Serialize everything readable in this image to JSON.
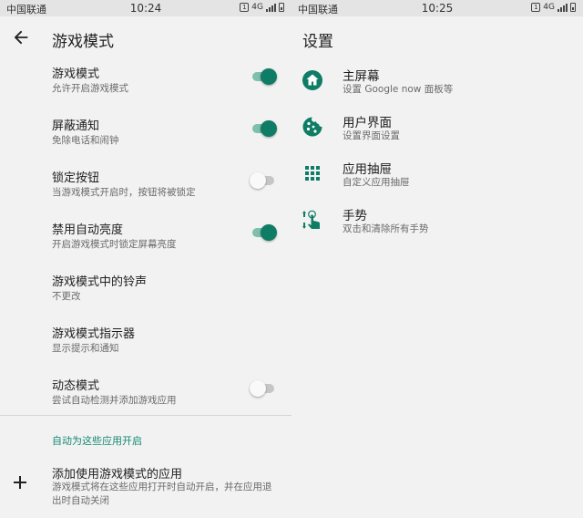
{
  "colors": {
    "accent": "#0f7c66",
    "accent_light": "#7fbfad",
    "section_header": "#138a72"
  },
  "left": {
    "statusbar": {
      "carrier": "中国联通",
      "time": "10:24",
      "network": "4G"
    },
    "title": "游戏模式",
    "settings": [
      {
        "label": "游戏模式",
        "sub": "允许开启游戏模式",
        "toggle": true,
        "on": true
      },
      {
        "label": "屏蔽通知",
        "sub": "免除电话和闹钟",
        "toggle": true,
        "on": true
      },
      {
        "label": "锁定按钮",
        "sub": "当游戏模式开启时，按钮将被锁定",
        "toggle": true,
        "on": false
      },
      {
        "label": "禁用自动亮度",
        "sub": "开启游戏模式时锁定屏幕亮度",
        "toggle": true,
        "on": true
      },
      {
        "label": "游戏模式中的铃声",
        "sub": "不更改",
        "toggle": false
      },
      {
        "label": "游戏模式指示器",
        "sub": "显示提示和通知",
        "toggle": false
      },
      {
        "label": "动态模式",
        "sub": "尝试自动检测并添加游戏应用",
        "toggle": true,
        "on": false
      }
    ],
    "section_header": "自动为这些应用开启",
    "add": {
      "label": "添加使用游戏模式的应用",
      "sub": "游戏模式将在这些应用打开时自动开启，并在应用退出时自动关闭"
    }
  },
  "right": {
    "statusbar": {
      "carrier": "中国联通",
      "time": "10:25",
      "network": "4G"
    },
    "title": "设置",
    "items": [
      {
        "icon": "home-icon",
        "label": "主屏幕",
        "sub": "设置 Google now 面板等"
      },
      {
        "icon": "cookie-icon",
        "label": "用户界面",
        "sub": "设置界面设置"
      },
      {
        "icon": "apps-grid-icon",
        "label": "应用抽屉",
        "sub": "自定义应用抽屉"
      },
      {
        "icon": "gesture-icon",
        "label": "手势",
        "sub": "双击和清除所有手势"
      }
    ]
  }
}
